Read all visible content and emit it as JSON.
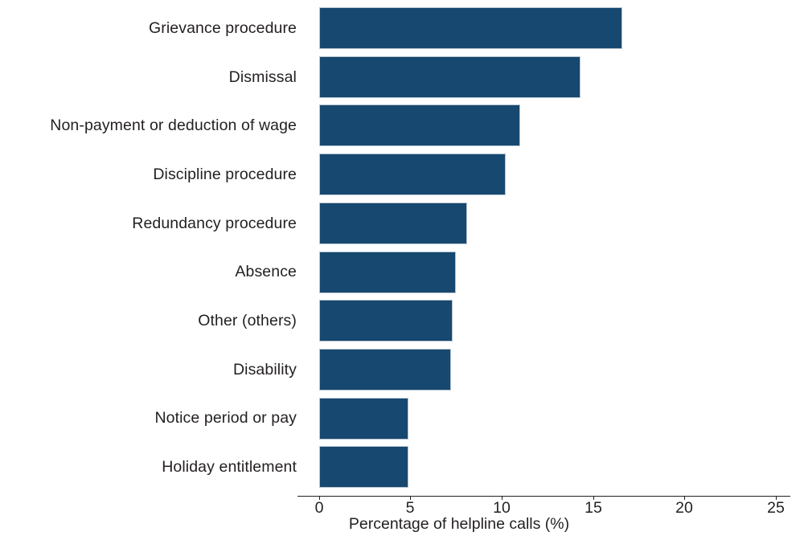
{
  "chart_data": {
    "type": "bar",
    "orientation": "horizontal",
    "title": "",
    "subtitle": "",
    "xlabel": "Percentage of helpline calls (%)",
    "ylabel": "",
    "xlim": [
      0,
      25
    ],
    "xticks": [
      0,
      5,
      10,
      15,
      20,
      25
    ],
    "xtick_labels": [
      "0",
      "5",
      "10",
      "15",
      "20",
      "25"
    ],
    "grid": false,
    "legend": false,
    "legend_position": "none",
    "bar_color": "#174870",
    "bar_edge_color": "#b9c6d2",
    "text_color": "#231f20",
    "background_color": "#ffffff",
    "categories": [
      "Grievance procedure",
      "Dismissal",
      "Non-payment or deduction of wage",
      "Discipline procedure",
      "Redundancy procedure",
      "Absence",
      "Other (others)",
      "Disability",
      "Notice period or pay",
      "Holiday entitlement"
    ],
    "values": [
      16.6,
      14.3,
      11.0,
      10.2,
      8.1,
      7.5,
      7.3,
      7.2,
      4.9,
      4.9
    ]
  }
}
